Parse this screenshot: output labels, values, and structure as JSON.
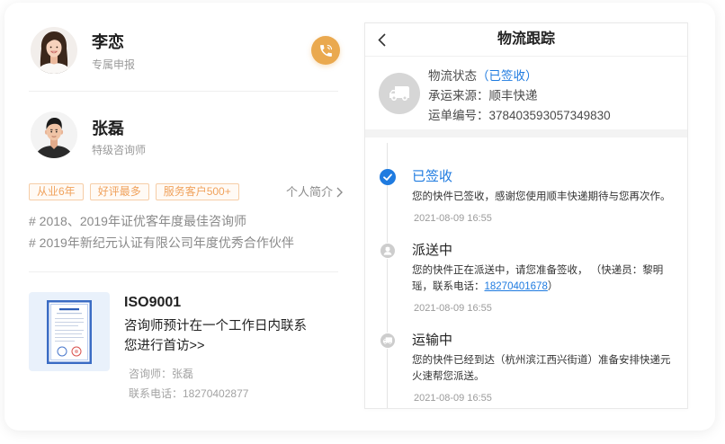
{
  "consultants": [
    {
      "name": "李恋",
      "role": "专属申报"
    },
    {
      "name": "张磊",
      "role": "特级咨询师"
    }
  ],
  "call_button": {
    "icon": "phone-icon"
  },
  "tags": [
    "从业6年",
    "好评最多",
    "服务客户500+"
  ],
  "profile_link": {
    "label": "个人简介",
    "icon": "chevron-right-icon"
  },
  "honors": [
    "# 2018、2019年证优客年度最佳咨询师",
    "# 2019年新纪元认证有限公司年度优秀合作伙伴"
  ],
  "service": {
    "name": "ISO9001",
    "description": "咨询师预计在一个工作日内联系您进行首访>>",
    "consultant": "咨询师：张磊",
    "phone": "联系电话：18270402877"
  },
  "tracking": {
    "back_icon": "chevron-left-icon",
    "title": "物流跟踪",
    "status_icon": "truck-icon",
    "status_label": "物流状态",
    "status_value": "（已签收）",
    "carrier": "承运来源：顺丰快递",
    "waybill": "运单编号：378403593057349830",
    "events": [
      {
        "icon": "check-icon",
        "title": "已签收",
        "desc": "您的快件已签收，感谢您使用顺丰快递期待与您再次作。",
        "time": "2021-08-09 16:55"
      },
      {
        "icon": "courier-icon",
        "title": "派送中",
        "desc": "您的快件正在派送中，请您准备签收， （快递员：黎明瑶，联系电话：",
        "desc_link": "18270401678",
        "desc_end": "）",
        "time": "2021-08-09 16:55"
      },
      {
        "icon": "truck-icon",
        "title": "运输中",
        "desc": "您的快件已经到达（杭州滨江西兴街道）准备安排快递元火速帮您派送。",
        "time": "2021-08-09 16:55"
      }
    ]
  },
  "colors": {
    "accent_blue": "#1f7be0",
    "brand_orange": "#eaa94f",
    "tag_orange": "#f0a25c",
    "tag_border": "#f6cda6"
  }
}
